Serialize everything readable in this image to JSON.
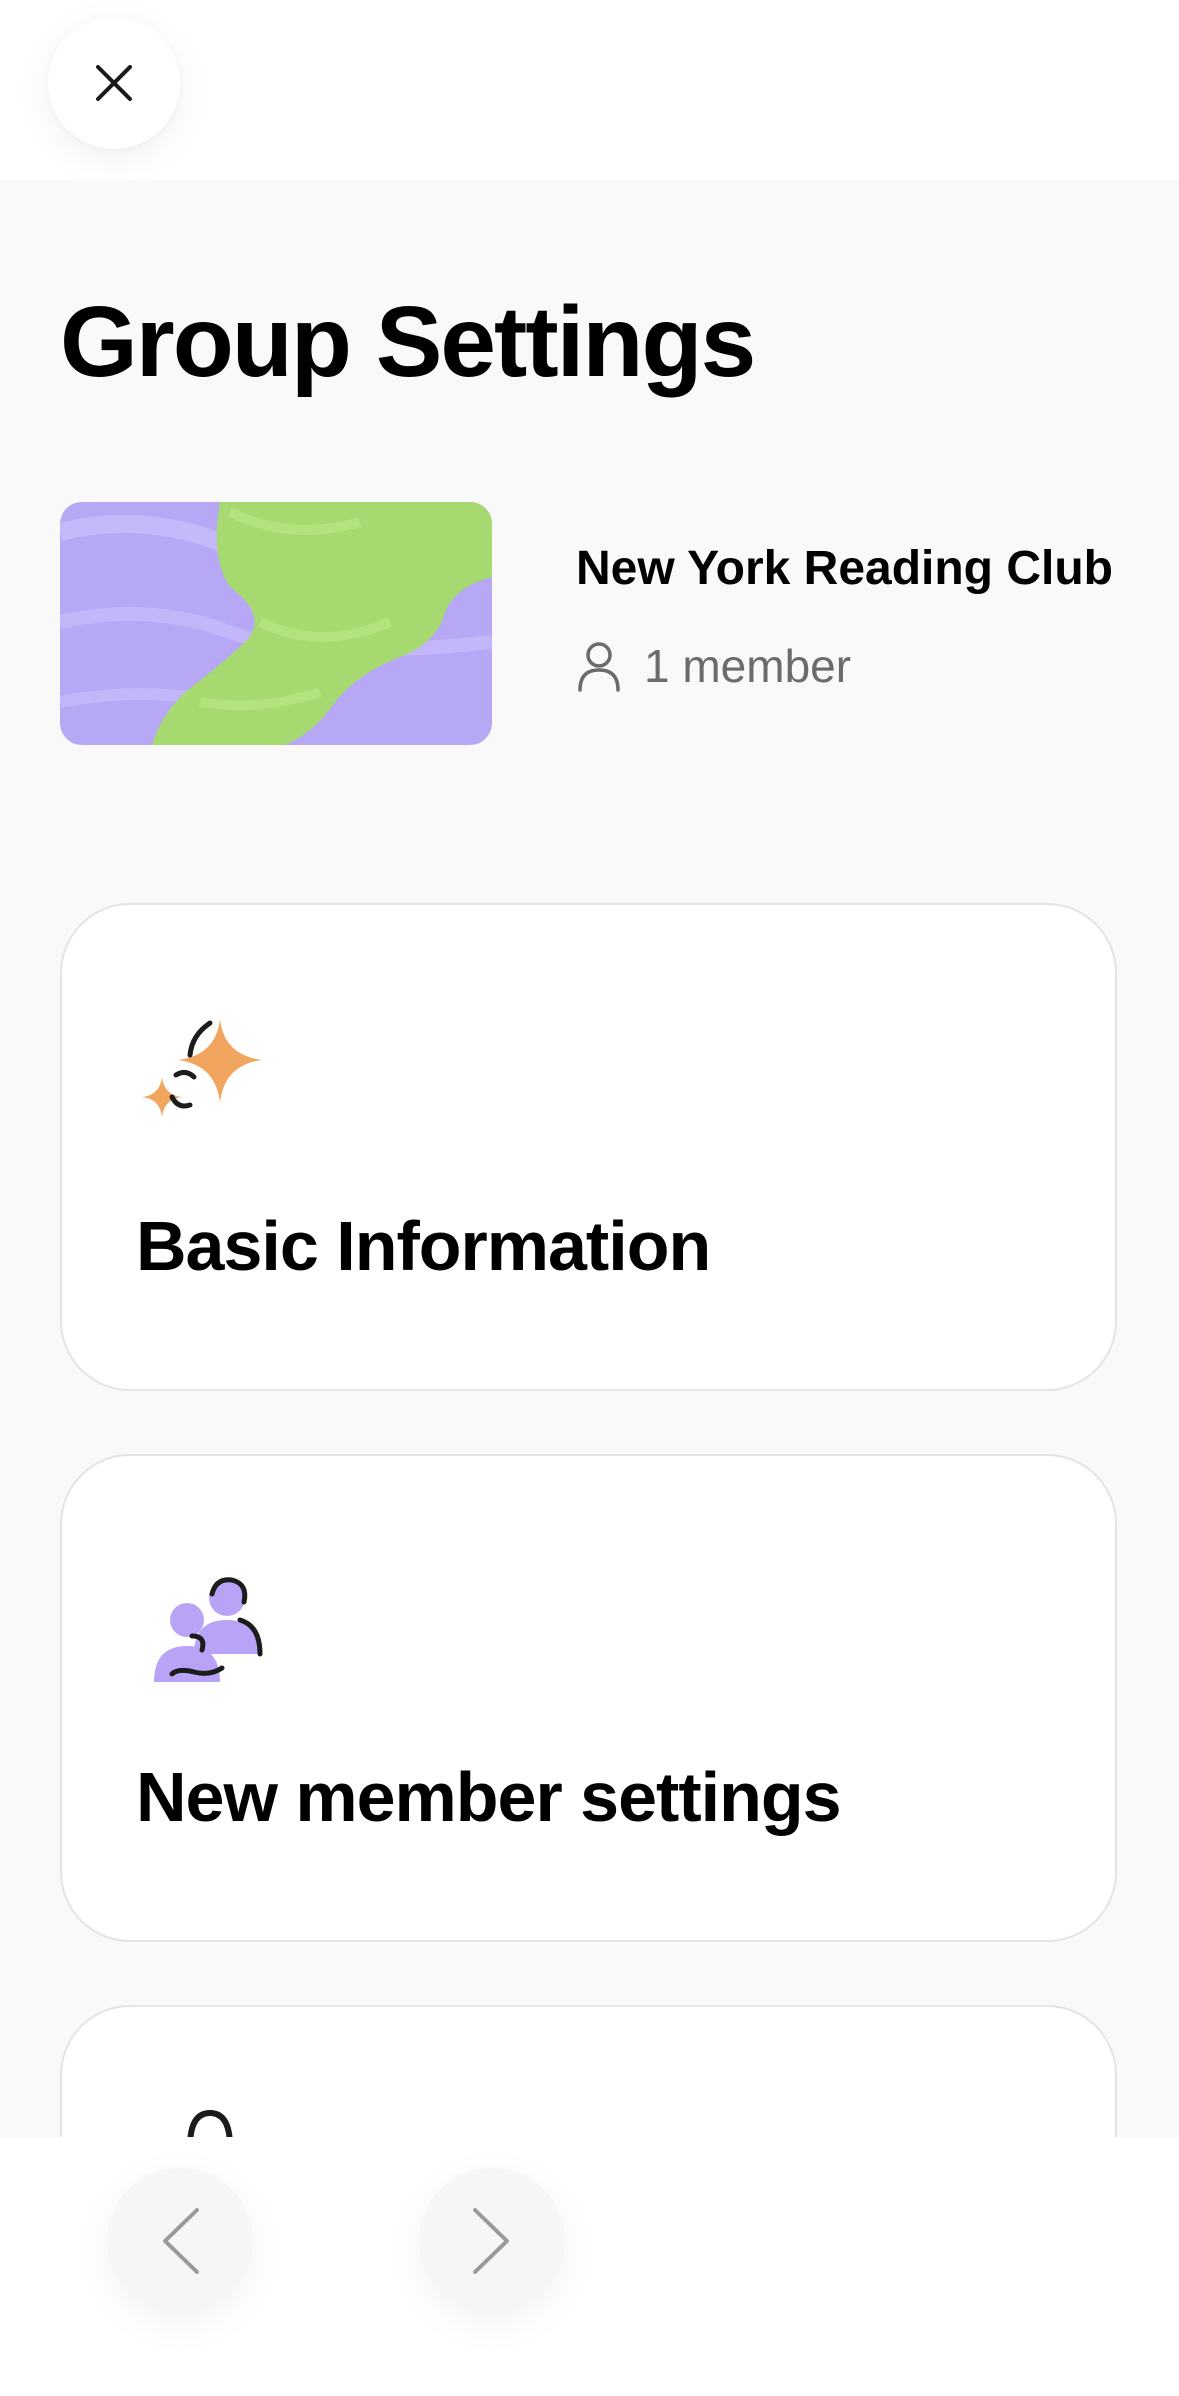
{
  "header": {
    "close_icon": "close-icon"
  },
  "page": {
    "title": "Group Settings"
  },
  "group": {
    "name": "New York Reading Club",
    "member_count_label": "1 member",
    "member_icon": "person-icon",
    "image_colors": {
      "background": "#b7a8f6",
      "blob": "#a6d970"
    }
  },
  "cards": [
    {
      "label": "Basic Information",
      "icon": "sparkle-icon"
    },
    {
      "label": "New member settings",
      "icon": "members-icon"
    },
    {
      "label": "",
      "icon": "lock-icon"
    }
  ],
  "bottom_nav": {
    "back_icon": "chevron-left-icon",
    "forward_icon": "chevron-right-icon"
  },
  "colors": {
    "accent_orange": "#f2a55f",
    "accent_purple": "#b9a3f7",
    "text_muted": "#6b6b6b"
  }
}
